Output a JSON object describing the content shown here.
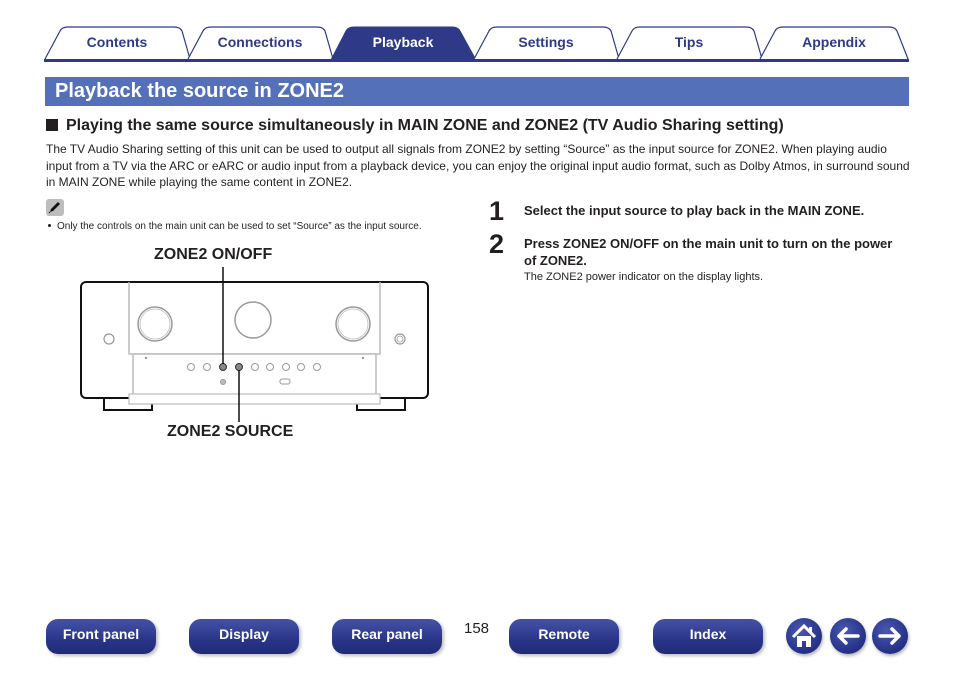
{
  "tabs": [
    {
      "label": "Contents",
      "active": false
    },
    {
      "label": "Connections",
      "active": false
    },
    {
      "label": "Playback",
      "active": true
    },
    {
      "label": "Settings",
      "active": false
    },
    {
      "label": "Tips",
      "active": false
    },
    {
      "label": "Appendix",
      "active": false
    }
  ],
  "page_title": "Playback the source in ZONE2",
  "section": {
    "heading": "Playing the same source simultaneously in MAIN ZONE and ZONE2 (TV Audio Sharing setting)",
    "intro": "The TV Audio Sharing setting of this unit can be used to output all signals from ZONE2 by setting “Source” as the input source for ZONE2. When playing audio input from a TV via the ARC or eARC or audio input from a playback device, you can enjoy the original input audio format, such as Dolby Atmos, in surround sound in MAIN ZONE while playing the same content in ZONE2.",
    "note_icon": "pencil-icon",
    "note": "Only the controls on the main unit can be used to set “Source” as the input source."
  },
  "diagram": {
    "label_top": "ZONE2 ON/OFF",
    "label_bottom": "ZONE2 SOURCE"
  },
  "steps": [
    {
      "num": "1",
      "text": "Select the input source to play back in the MAIN ZONE."
    },
    {
      "num": "2",
      "text": "Press ZONE2 ON/OFF on the main unit to turn on the power of ZONE2.",
      "sub": "The ZONE2 power indicator on the display lights."
    }
  ],
  "footer": {
    "buttons": [
      "Front panel",
      "Display",
      "Rear panel",
      "Remote",
      "Index"
    ],
    "page_number": "158",
    "icons": [
      "home-icon",
      "arrow-left-icon",
      "arrow-right-icon"
    ]
  },
  "colors": {
    "brand": "#2e3a87",
    "title_bar": "#5470b8"
  }
}
